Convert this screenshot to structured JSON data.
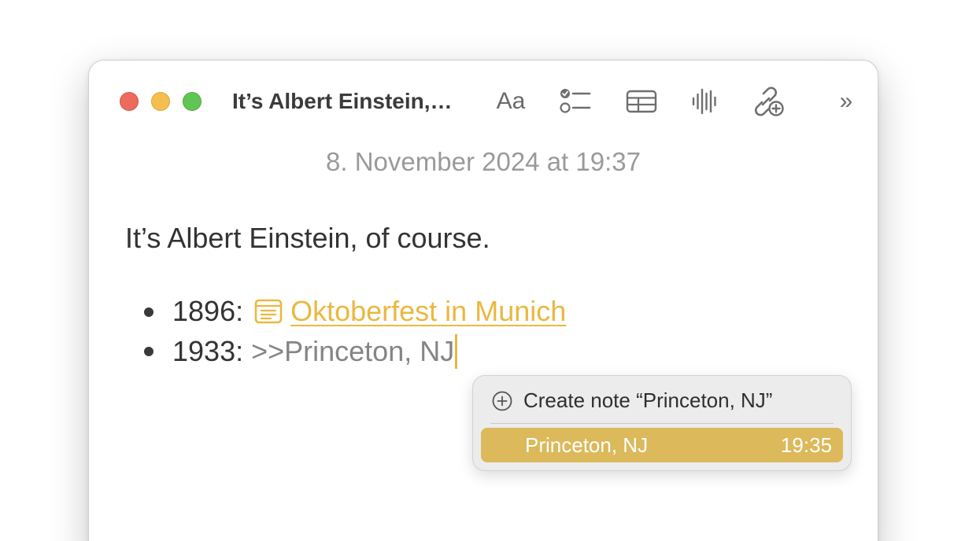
{
  "window": {
    "title": "It’s Albert Einstein,…",
    "toolbar": {
      "format_label": "Aa",
      "checklist_icon": "checklist-icon",
      "table_icon": "table-icon",
      "audio_icon": "audio-waveform-icon",
      "link_icon": "add-link-icon",
      "more_label": "»"
    }
  },
  "note": {
    "date": "8. November 2024 at 19:37",
    "heading": "It’s Albert Einstein, of course.",
    "items": [
      {
        "prefix": "1896:",
        "link_text": "Oktoberfest in Munich",
        "icon": "note-icon"
      },
      {
        "prefix": "1933:",
        "typed_text": ">>Princeton, NJ"
      }
    ]
  },
  "popup": {
    "create_label": "Create note “Princeton, NJ”",
    "suggestion": {
      "title": "Princeton, NJ",
      "time": "19:35"
    }
  },
  "colors": {
    "accent": "#eab840",
    "selection": "#dcb95a",
    "close": "#ee6a5e",
    "minimize": "#f5bf4f",
    "zoom": "#61c554"
  }
}
